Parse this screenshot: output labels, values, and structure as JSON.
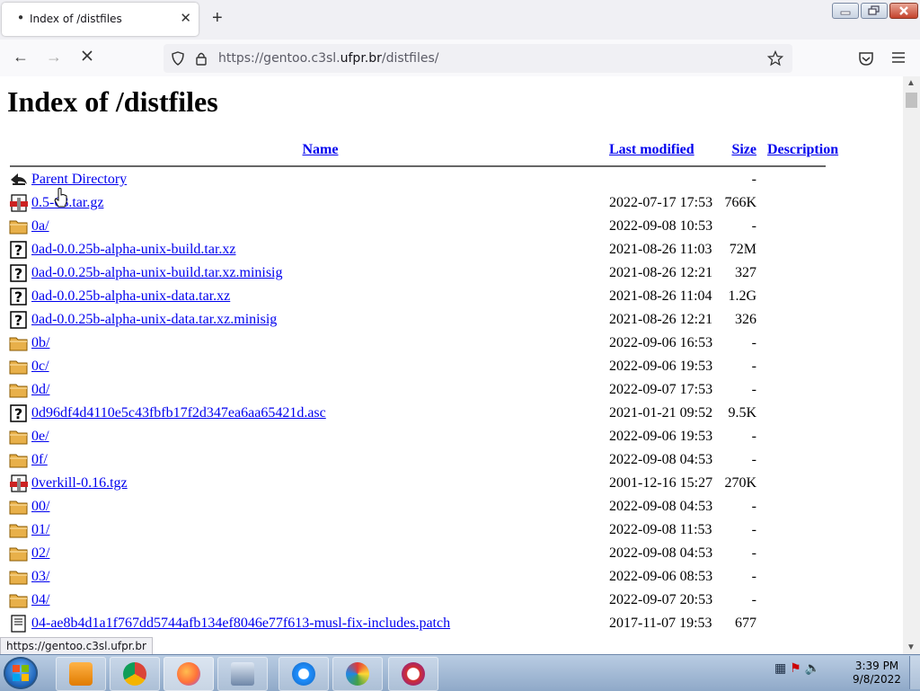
{
  "tab": {
    "title": "Index of /distfiles",
    "close": "✕",
    "new_tab": "+"
  },
  "nav": {
    "back": "←",
    "forward": "→",
    "reload": "↻",
    "url_prefix": "https://gentoo.c3sl.",
    "url_domain": "ufpr.br",
    "url_suffix": "/distfiles/"
  },
  "page": {
    "title": "Index of /distfiles",
    "columns": {
      "name": "Name",
      "last_modified": "Last modified",
      "size": "Size",
      "description": "Description"
    },
    "rows": [
      {
        "icon": "back-icon",
        "name": "Parent Directory",
        "date": "",
        "size": "-"
      },
      {
        "icon": "compressed-icon",
        "name": "0.5-63.tar.gz",
        "date": "2022-07-17 17:53",
        "size": "766K"
      },
      {
        "icon": "folder-icon",
        "name": "0a/",
        "date": "2022-09-08 10:53",
        "size": "-"
      },
      {
        "icon": "unknown-icon",
        "name": "0ad-0.0.25b-alpha-unix-build.tar.xz",
        "date": "2021-08-26 11:03",
        "size": "72M"
      },
      {
        "icon": "unknown-icon",
        "name": "0ad-0.0.25b-alpha-unix-build.tar.xz.minisig",
        "date": "2021-08-26 12:21",
        "size": "327"
      },
      {
        "icon": "unknown-icon",
        "name": "0ad-0.0.25b-alpha-unix-data.tar.xz",
        "date": "2021-08-26 11:04",
        "size": "1.2G"
      },
      {
        "icon": "unknown-icon",
        "name": "0ad-0.0.25b-alpha-unix-data.tar.xz.minisig",
        "date": "2021-08-26 12:21",
        "size": "326"
      },
      {
        "icon": "folder-icon",
        "name": "0b/",
        "date": "2022-09-06 16:53",
        "size": "-"
      },
      {
        "icon": "folder-icon",
        "name": "0c/",
        "date": "2022-09-06 19:53",
        "size": "-"
      },
      {
        "icon": "folder-icon",
        "name": "0d/",
        "date": "2022-09-07 17:53",
        "size": "-"
      },
      {
        "icon": "unknown-icon",
        "name": "0d96df4d4110e5c43fbfb17f2d347ea6aa65421d.asc",
        "date": "2021-01-21 09:52",
        "size": "9.5K"
      },
      {
        "icon": "folder-icon",
        "name": "0e/",
        "date": "2022-09-06 19:53",
        "size": "-"
      },
      {
        "icon": "folder-icon",
        "name": "0f/",
        "date": "2022-09-08 04:53",
        "size": "-"
      },
      {
        "icon": "compressed-icon",
        "name": "0verkill-0.16.tgz",
        "date": "2001-12-16 15:27",
        "size": "270K"
      },
      {
        "icon": "folder-icon",
        "name": "00/",
        "date": "2022-09-08 04:53",
        "size": "-"
      },
      {
        "icon": "folder-icon",
        "name": "01/",
        "date": "2022-09-08 11:53",
        "size": "-"
      },
      {
        "icon": "folder-icon",
        "name": "02/",
        "date": "2022-09-08 04:53",
        "size": "-"
      },
      {
        "icon": "folder-icon",
        "name": "03/",
        "date": "2022-09-06 08:53",
        "size": "-"
      },
      {
        "icon": "folder-icon",
        "name": "04/",
        "date": "2022-09-07 20:53",
        "size": "-"
      },
      {
        "icon": "text-icon",
        "name": "04-ae8b4d1a1f767dd5744afb134ef8046e77f613-musl-fix-includes.patch",
        "date": "2017-11-07 19:53",
        "size": "677"
      }
    ]
  },
  "status_url": "https://gentoo.c3sl.ufpr.br",
  "clock": {
    "time": "3:39 PM",
    "date": "9/8/2022"
  },
  "colors": {
    "link": "#0000ee",
    "folder": "#e8b04a",
    "tab_strip": "#f0f0f4"
  }
}
